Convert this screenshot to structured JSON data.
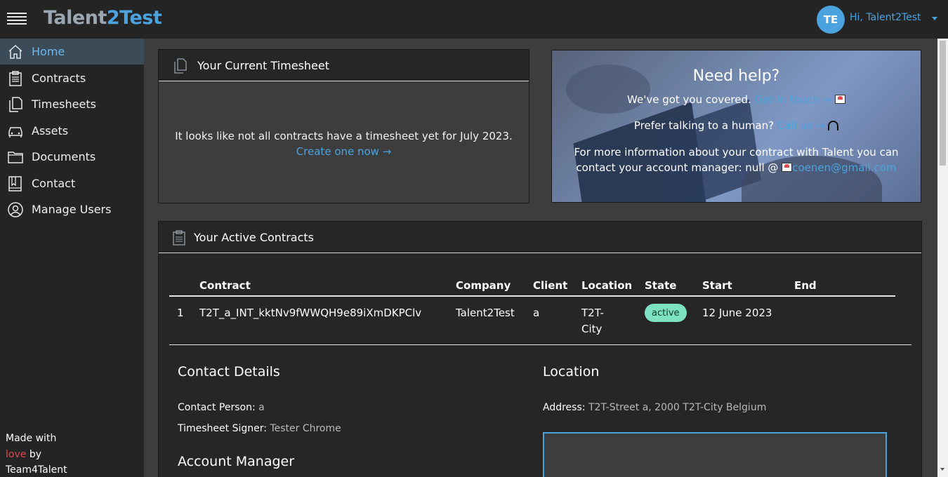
{
  "topbar": {
    "logo_part1": "Talent",
    "logo_part2": "2Test",
    "avatar_initials": "TE",
    "greeting": "Hi, Talent2Test"
  },
  "sidebar": {
    "items": [
      {
        "label": "Home",
        "icon": "home-icon",
        "active": true
      },
      {
        "label": "Contracts",
        "icon": "clipboard-icon"
      },
      {
        "label": "Timesheets",
        "icon": "documents-icon"
      },
      {
        "label": "Assets",
        "icon": "car-icon"
      },
      {
        "label": "Documents",
        "icon": "folder-icon"
      },
      {
        "label": "Contact",
        "icon": "book-icon"
      },
      {
        "label": "Manage Users",
        "icon": "user-circle-icon"
      }
    ],
    "footer": {
      "made_with": "Made with",
      "love": "love",
      "by": "by",
      "team": "Team4Talent"
    }
  },
  "timesheet_card": {
    "title": "Your Current Timesheet",
    "message": "It looks like not all contracts have a timesheet yet for July 2023.",
    "link": "Create one now →"
  },
  "help_card": {
    "title": "Need help?",
    "line1": "We've got you covered.",
    "line1_link": "Get in touch →",
    "line2": "Prefer talking to a human?",
    "line2_link": "Call us →",
    "line3": "For more information about your contract with Talent you can",
    "line4": "contact your account manager: null @",
    "email": "coenen@gmail.com"
  },
  "contracts_card": {
    "title": "Your Active Contracts",
    "columns": [
      "Contract",
      "Company",
      "Client",
      "Location",
      "State",
      "Start",
      "End"
    ],
    "rows": [
      {
        "index": "1",
        "contract": "T2T_a_INT_kktNv9fWWQH9e89iXmDKPClv",
        "company": "Talent2Test",
        "client": "a",
        "location_line1": "T2T-",
        "location_line2": "City",
        "state": "active",
        "start": "12 June 2023",
        "end": ""
      }
    ],
    "details": {
      "contact_title": "Contact Details",
      "contact_person_label": "Contact Person:",
      "contact_person_value": "a",
      "signer_label": "Timesheet Signer:",
      "signer_value": "Tester Chrome",
      "account_manager_title": "Account Manager",
      "location_title": "Location",
      "address_label": "Address:",
      "address_value": "T2T-Street a, 2000 T2T-City Belgium"
    }
  },
  "colors": {
    "accent": "#4aa3df",
    "active_badge": "#7de2c1",
    "sidebar_bg": "#242424",
    "love": "#e0494f"
  }
}
